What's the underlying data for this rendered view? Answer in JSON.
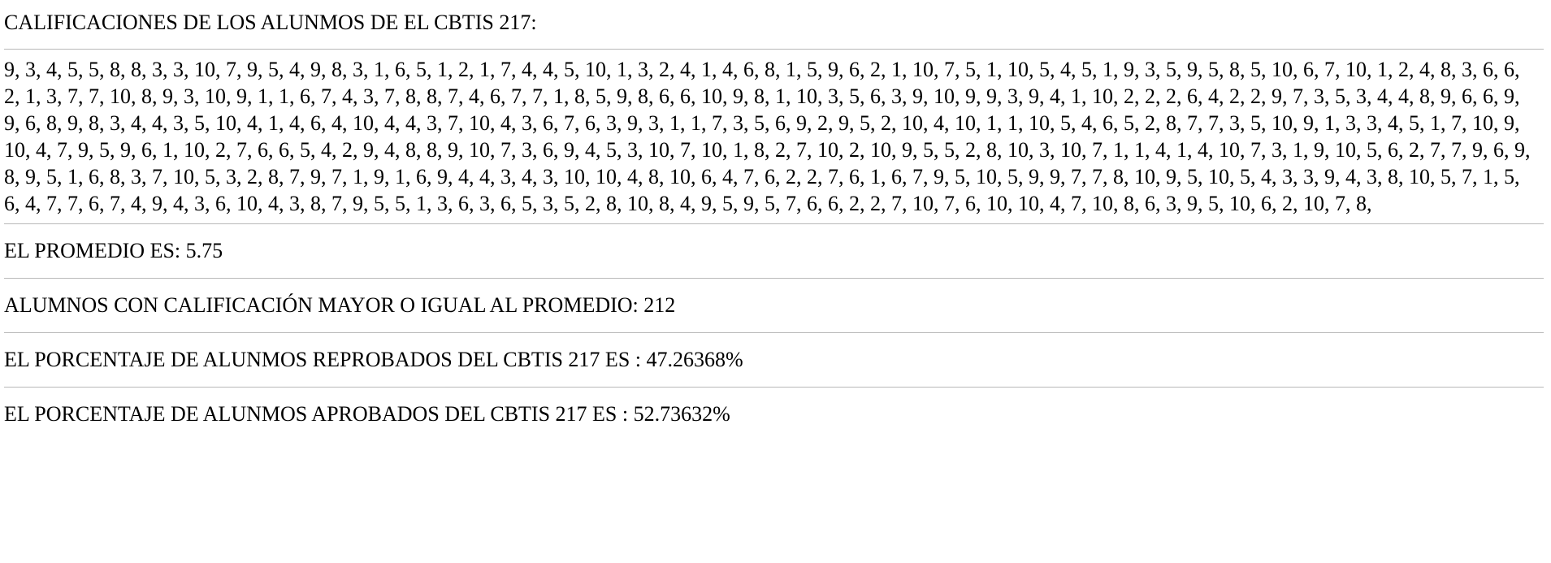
{
  "heading": "CALIFICACIONES DE LOS ALUNMOS DE EL CBTIS 217:",
  "grades_text": "9, 3, 4, 5, 5, 8, 8, 3, 3, 10, 7, 9, 5, 4, 9, 8, 3, 1, 6, 5, 1, 2, 1, 7, 4, 4, 5, 10, 1, 3, 2, 4, 1, 4, 6, 8, 1, 5, 9, 6, 2, 1, 10, 7, 5, 1, 10, 5, 4, 5, 1, 9, 3, 5, 9, 5, 8, 5, 10, 6, 7, 10, 1, 2, 4, 8, 3, 6, 6, 2, 1, 3, 7, 7, 10, 8, 9, 3, 10, 9, 1, 1, 6, 7, 4, 3, 7, 8, 8, 7, 4, 6, 7, 7, 1, 8, 5, 9, 8, 6, 6, 10, 9, 8, 1, 10, 3, 5, 6, 3, 9, 10, 9, 9, 3, 9, 4, 1, 10, 2, 2, 2, 6, 4, 2, 2, 9, 7, 3, 5, 3, 4, 4, 8, 9, 6, 6, 9, 9, 6, 8, 9, 8, 3, 4, 4, 3, 5, 10, 4, 1, 4, 6, 4, 10, 4, 4, 3, 7, 10, 4, 3, 6, 7, 6, 3, 9, 3, 1, 1, 7, 3, 5, 6, 9, 2, 9, 5, 2, 10, 4, 10, 1, 1, 10, 5, 4, 6, 5, 2, 8, 7, 7, 3, 5, 10, 9, 1, 3, 3, 4, 5, 1, 7, 10, 9, 10, 4, 7, 9, 5, 9, 6, 1, 10, 2, 7, 6, 6, 5, 4, 2, 9, 4, 8, 8, 9, 10, 7, 3, 6, 9, 4, 5, 3, 10, 7, 10, 1, 8, 2, 7, 10, 2, 10, 9, 5, 5, 2, 8, 10, 3, 10, 7, 1, 1, 4, 1, 4, 10, 7, 3, 1, 9, 10, 5, 6, 2, 7, 7, 9, 6, 9, 8, 9, 5, 1, 6, 8, 3, 7, 10, 5, 3, 2, 8, 7, 9, 7, 1, 9, 1, 6, 9, 4, 4, 3, 4, 3, 10, 10, 4, 8, 10, 6, 4, 7, 6, 2, 2, 7, 6, 1, 6, 7, 9, 5, 10, 5, 9, 9, 7, 7, 8, 10, 9, 5, 10, 5, 4, 3, 3, 9, 4, 3, 8, 10, 5, 7, 1, 5, 6, 4, 7, 7, 6, 7, 4, 9, 4, 3, 6, 10, 4, 3, 8, 7, 9, 5, 5, 1, 3, 6, 3, 6, 5, 3, 5, 2, 8, 10, 8, 4, 9, 5, 9, 5, 7, 6, 6, 2, 2, 7, 10, 7, 6, 10, 10, 4, 7, 10, 8, 6, 3, 9, 5, 10, 6, 2, 10, 7, 8,",
  "stats": {
    "average": "EL PROMEDIO ES: 5.75",
    "above_average": "ALUMNOS CON CALIFICACIÓN MAYOR O IGUAL AL PROMEDIO: 212",
    "failed_pct": "EL PORCENTAJE DE ALUNMOS REPROBADOS DEL CBTIS 217 ES : 47.26368%",
    "passed_pct": "EL PORCENTAJE DE ALUNMOS APROBADOS DEL CBTIS 217 ES : 52.73632%"
  }
}
